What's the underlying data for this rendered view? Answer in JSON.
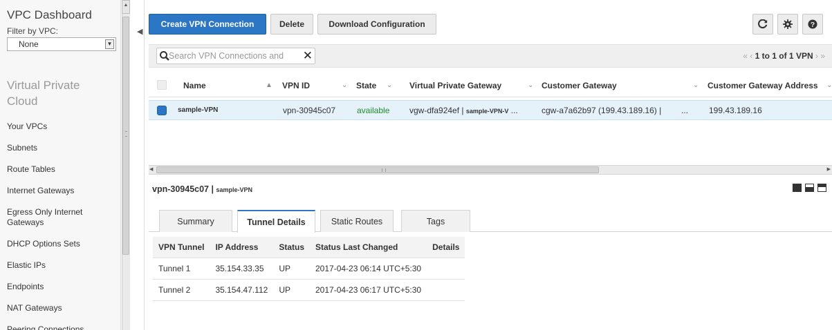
{
  "sidebar": {
    "title": "VPC Dashboard",
    "filter_label": "Filter by VPC:",
    "filter_value": "None",
    "section": "Virtual Private Cloud",
    "items": [
      {
        "label": "Your VPCs"
      },
      {
        "label": "Subnets"
      },
      {
        "label": "Route Tables"
      },
      {
        "label": "Internet Gateways"
      },
      {
        "label": "Egress Only Internet Gateways"
      },
      {
        "label": "DHCP Options Sets"
      },
      {
        "label": "Elastic IPs"
      },
      {
        "label": "Endpoints"
      },
      {
        "label": "NAT Gateways"
      },
      {
        "label": "Peering Connections"
      }
    ]
  },
  "toolbar": {
    "create_label": "Create VPN Connection",
    "delete_label": "Delete",
    "download_label": "Download Configuration",
    "refresh_icon": "refresh-icon",
    "settings_icon": "gear-icon",
    "help_icon": "help-icon"
  },
  "search": {
    "placeholder": "Search VPN Connections and"
  },
  "pager": {
    "text": "1 to 1 of 1 VPN"
  },
  "table": {
    "columns": [
      {
        "label": "Name"
      },
      {
        "label": "VPN ID"
      },
      {
        "label": "State"
      },
      {
        "label": "Virtual Private Gateway"
      },
      {
        "label": "Customer Gateway"
      },
      {
        "label": "Customer Gateway Address"
      }
    ],
    "rows": [
      {
        "name": "sample-VPN",
        "vpn_id": "vpn-30945c07",
        "state": "available",
        "vgw_prefix": "vgw-dfa924ef |",
        "vgw_name": "sample-VPN-V",
        "vgw_suffix": "...",
        "cgw_prefix": "cgw-a7a62b97 (199.43.189.16) |",
        "cgw_suffix": "...",
        "cgw_address": "199.43.189.16"
      }
    ]
  },
  "details": {
    "vpn_id": "vpn-30945c07 |",
    "vpn_name": "sample-VPN",
    "tabs": [
      {
        "label": "Summary"
      },
      {
        "label": "Tunnel Details"
      },
      {
        "label": "Static Routes"
      },
      {
        "label": "Tags"
      }
    ],
    "active_tab": "Tunnel Details",
    "tunnel_columns": [
      "VPN Tunnel",
      "IP Address",
      "Status",
      "Status Last Changed",
      "Details"
    ],
    "tunnels": [
      {
        "tunnel": "Tunnel 1",
        "ip": "35.154.33.35",
        "status": "UP",
        "changed": "2017-04-23 06:14 UTC+5:30",
        "details": ""
      },
      {
        "tunnel": "Tunnel 2",
        "ip": "35.154.47.112",
        "status": "UP",
        "changed": "2017-04-23 06:17 UTC+5:30",
        "details": ""
      }
    ]
  },
  "colors": {
    "primary": "#2c77c5",
    "available": "#1f8a2b",
    "selected_row": "#e6f2fa"
  }
}
